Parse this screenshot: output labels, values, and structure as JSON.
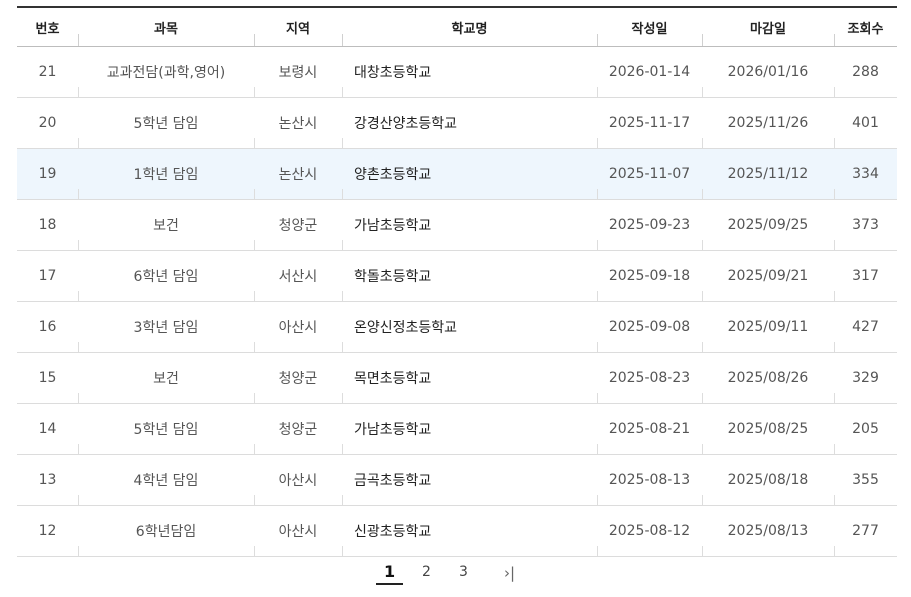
{
  "table": {
    "headers": [
      "번호",
      "과목",
      "지역",
      "학교명",
      "작성일",
      "마감일",
      "조회수"
    ],
    "rows": [
      {
        "no": "21",
        "subject": "교과전담(과학,영어)",
        "region": "보령시",
        "school": "대창초등학교",
        "written": "2026-01-14",
        "deadline": "2026/01/16",
        "views": "288"
      },
      {
        "no": "20",
        "subject": "5학년 담임",
        "region": "논산시",
        "school": "강경산양초등학교",
        "written": "2025-11-17",
        "deadline": "2025/11/26",
        "views": "401"
      },
      {
        "no": "19",
        "subject": "1학년 담임",
        "region": "논산시",
        "school": "양촌초등학교",
        "written": "2025-11-07",
        "deadline": "2025/11/12",
        "views": "334"
      },
      {
        "no": "18",
        "subject": "보건",
        "region": "청양군",
        "school": "가남초등학교",
        "written": "2025-09-23",
        "deadline": "2025/09/25",
        "views": "373"
      },
      {
        "no": "17",
        "subject": "6학년 담임",
        "region": "서산시",
        "school": "학돌초등학교",
        "written": "2025-09-18",
        "deadline": "2025/09/21",
        "views": "317"
      },
      {
        "no": "16",
        "subject": "3학년 담임",
        "region": "아산시",
        "school": "온양신정초등학교",
        "written": "2025-09-08",
        "deadline": "2025/09/11",
        "views": "427"
      },
      {
        "no": "15",
        "subject": "보건",
        "region": "청양군",
        "school": "목면초등학교",
        "written": "2025-08-23",
        "deadline": "2025/08/26",
        "views": "329"
      },
      {
        "no": "14",
        "subject": "5학년 담임",
        "region": "청양군",
        "school": "가남초등학교",
        "written": "2025-08-21",
        "deadline": "2025/08/25",
        "views": "205"
      },
      {
        "no": "13",
        "subject": "4학년 담임",
        "region": "아산시",
        "school": "금곡초등학교",
        "written": "2025-08-13",
        "deadline": "2025/08/18",
        "views": "355"
      },
      {
        "no": "12",
        "subject": "6학년담임",
        "region": "아산시",
        "school": "신광초등학교",
        "written": "2025-08-12",
        "deadline": "2025/08/13",
        "views": "277"
      }
    ]
  },
  "pagination": {
    "pages": [
      "1",
      "2",
      "3"
    ],
    "current": "1",
    "last_icon": "last-page-icon",
    "last_glyph": "›|"
  },
  "colors": {
    "highlight_row": "#eef6fd",
    "header_border": "#333333"
  }
}
